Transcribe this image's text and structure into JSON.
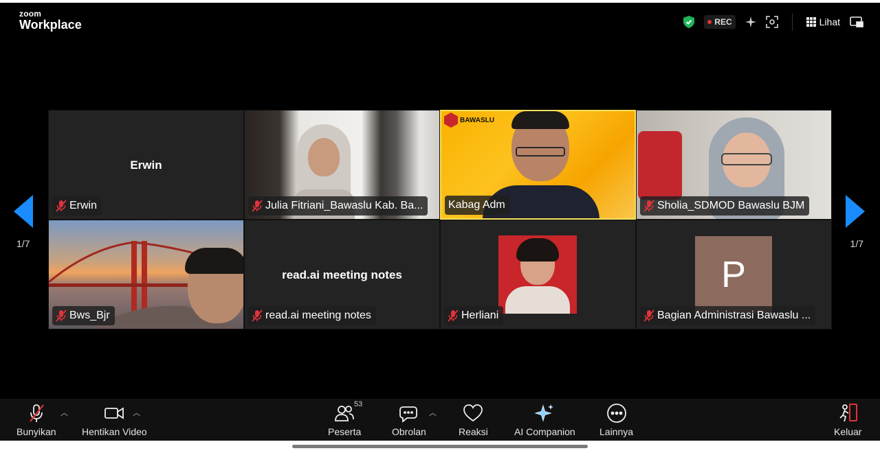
{
  "app": {
    "brand_small": "zoom",
    "brand_big": "Workplace"
  },
  "header": {
    "rec_label": "REC",
    "view_label": "Lihat"
  },
  "pagination": {
    "left": "1/7",
    "right": "1/7"
  },
  "tiles": [
    {
      "name": "Erwin",
      "center_name": "Erwin",
      "video": false
    },
    {
      "name": "Julia Fitriani_Bawaslu Kab. Ba...",
      "video": true
    },
    {
      "name": "Kabag Adm",
      "video": true,
      "active": true,
      "logo_text": "BAWASLU"
    },
    {
      "name": "Sholia_SDMOD Bawaslu BJM",
      "video": true
    },
    {
      "name": "Bws_Bjr",
      "video": true
    },
    {
      "name": "read.ai meeting notes",
      "center_name": "read.ai meeting notes",
      "video": false
    },
    {
      "name": "Herliani",
      "video": false,
      "avatar": "photo"
    },
    {
      "name": "Bagian Administrasi Bawaslu ...",
      "video": false,
      "avatar_letter": "P"
    }
  ],
  "toolbar": {
    "unmute": "Bunyikan",
    "stop_video": "Hentikan Video",
    "participants": "Peserta",
    "participants_count": "53",
    "chat": "Obrolan",
    "reactions": "Reaksi",
    "ai_companion": "AI Companion",
    "more": "Lainnya",
    "leave": "Keluar"
  },
  "colors": {
    "accent": "#1a8cff",
    "active_border": "#f7e15a",
    "rec_dot": "#e0333a",
    "muted": "#e0333a",
    "shield": "#1fb35a"
  }
}
